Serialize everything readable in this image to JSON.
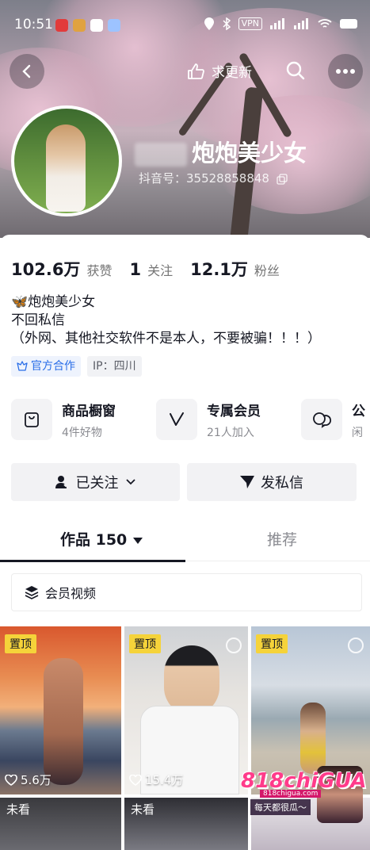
{
  "status_bar": {
    "time": "10:51",
    "vpn": "VPN"
  },
  "header": {
    "request_update": "求更新"
  },
  "profile": {
    "nickname": "炮炮美少女",
    "douyin_id": "抖音号：35528858848",
    "stats": [
      {
        "value": "102.6万",
        "label": "获赞"
      },
      {
        "value": "1",
        "label": "关注"
      },
      {
        "value": "12.1万",
        "label": "粉丝"
      }
    ],
    "bio_lines": [
      "🦋炮炮美少女",
      "不回私信",
      "（外网、其他社交软件不是本人，不要被骗！！！）"
    ],
    "tags": [
      {
        "label": "官方合作",
        "icon": "official-icon"
      },
      {
        "label": "IP：四川"
      }
    ]
  },
  "services": [
    {
      "title": "商品橱窗",
      "subtitle": "4件好物",
      "icon": "shopping-bag-icon"
    },
    {
      "title": "专属会员",
      "subtitle": "21人加入",
      "icon": "vip-v-icon"
    },
    {
      "title": "公",
      "subtitle": "闲",
      "icon": "chat-bubbles-icon"
    }
  ],
  "actions": {
    "follow": "已关注",
    "message": "发私信"
  },
  "tabs": {
    "works": "作品 150",
    "recommend": "推荐"
  },
  "member_videos": "会员视频",
  "videos": [
    {
      "pinned": "置顶",
      "likes": "5.6万"
    },
    {
      "pinned": "置顶",
      "likes": "15.4万"
    },
    {
      "pinned": "置顶"
    },
    {
      "unseen": "未看"
    },
    {
      "unseen": "未看"
    }
  ],
  "watermark": {
    "brand": "818chiGUA",
    "site": "818chigua.com",
    "tagline": "每天都很瓜～"
  },
  "colors": {
    "accent_blue": "#2a6ee8",
    "pin_yellow": "#f5d33a",
    "text_dark": "#161823"
  }
}
